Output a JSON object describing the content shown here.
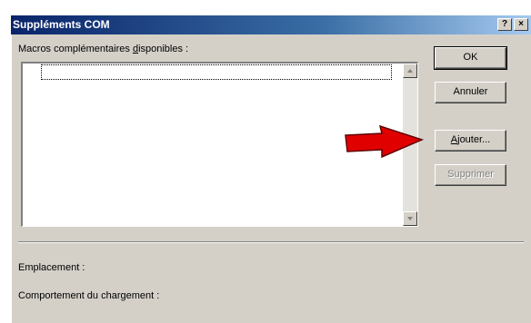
{
  "dialog": {
    "title": "Suppléments COM",
    "help_button": "?",
    "close_button": "×"
  },
  "list": {
    "label_before": "Macros complémentaires ",
    "label_hotkey": "d",
    "label_after": "isponibles :",
    "items": []
  },
  "buttons": {
    "ok": "OK",
    "annuler": "Annuler",
    "ajouter_hotkey": "A",
    "ajouter_rest": "jouter...",
    "supprimer": "Supprimer"
  },
  "info": {
    "emplacement_label": "Emplacement :",
    "comportement_label": "Comportement du chargement :"
  },
  "annotation": {
    "arrow_color": "#e00000"
  },
  "colors": {
    "face": "#d4d0c8",
    "title_start": "#0a246a",
    "title_end": "#a6caf0"
  }
}
